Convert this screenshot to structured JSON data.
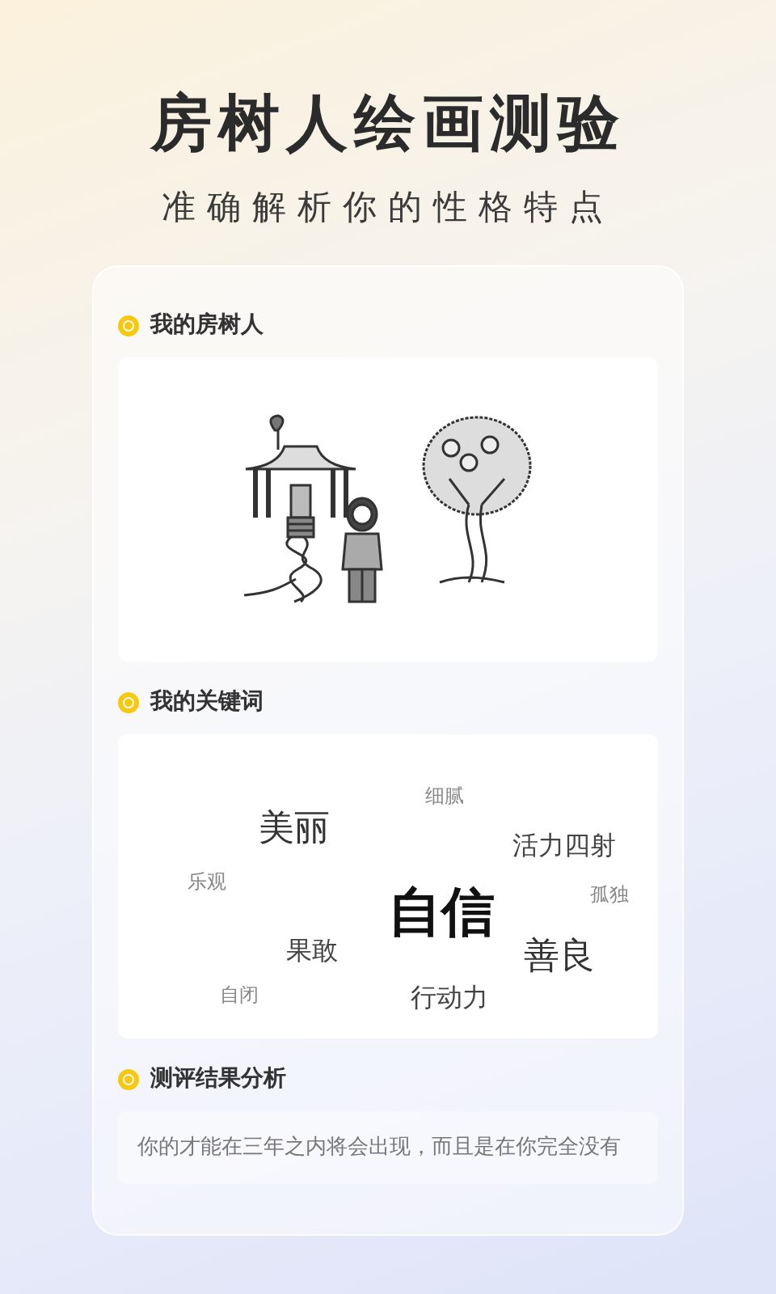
{
  "header": {
    "title": "房树人绘画测验",
    "subtitle": "准确解析你的性格特点"
  },
  "sections": [
    {
      "title": "我的房树人",
      "kind": "drawing"
    },
    {
      "title": "我的关键词",
      "kind": "keywords",
      "keywords": [
        {
          "text": "细腻",
          "kind": "small"
        },
        {
          "text": "美丽",
          "kind": "large"
        },
        {
          "text": "活力四射",
          "kind": "medium"
        },
        {
          "text": "乐观",
          "kind": "small"
        },
        {
          "text": "自信",
          "kind": "main"
        },
        {
          "text": "孤独",
          "kind": "small"
        },
        {
          "text": "果敢",
          "kind": "medium"
        },
        {
          "text": "善良",
          "kind": "large"
        },
        {
          "text": "自闭",
          "kind": "small"
        },
        {
          "text": "行动力",
          "kind": "medium"
        }
      ]
    },
    {
      "title": "测评结果分析",
      "kind": "analysis",
      "text": "你的才能在三年之内将会出现，而且是在你完全没有"
    }
  ]
}
